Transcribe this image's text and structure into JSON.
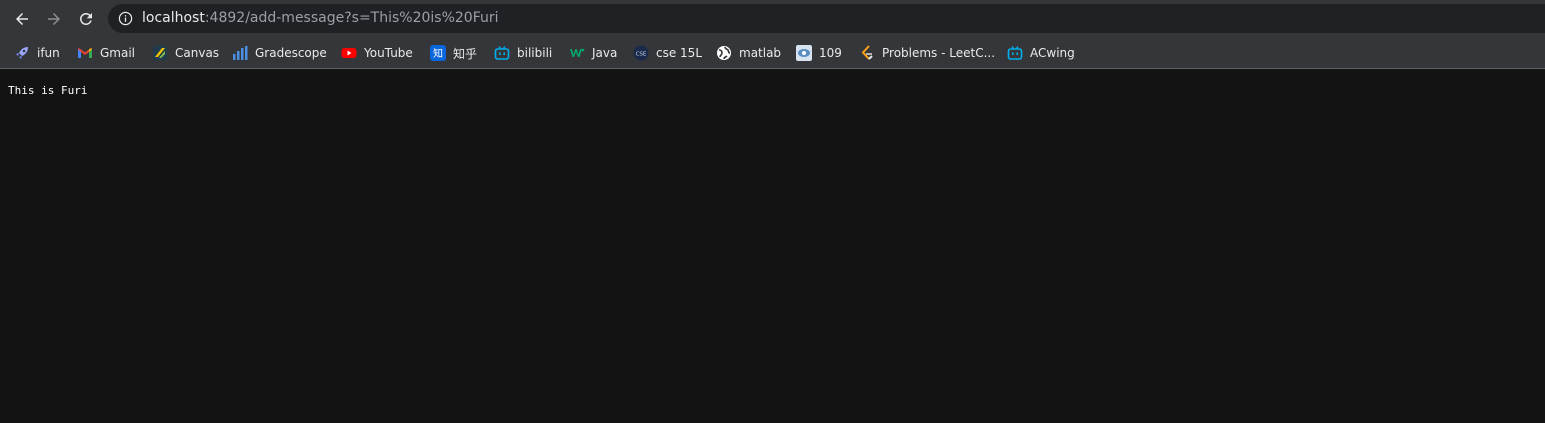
{
  "browser": {
    "url_host": "localhost",
    "url_rest": ":4892/add-message?s=This%20is%20Furi"
  },
  "nav": {
    "back_icon": "arrow-left-icon",
    "forward_icon": "arrow-right-icon",
    "reload_icon": "reload-icon",
    "info_icon": "info-icon"
  },
  "bookmarks": [
    {
      "label": "ifun",
      "icon": "rocket-icon"
    },
    {
      "label": "Gmail",
      "icon": "gmail-icon"
    },
    {
      "label": "Canvas",
      "icon": "canvas-icon"
    },
    {
      "label": "Gradescope",
      "icon": "bar-chart-icon"
    },
    {
      "label": "YouTube",
      "icon": "youtube-icon"
    },
    {
      "label": "知乎",
      "icon": "zhihu-icon"
    },
    {
      "label": "bilibili",
      "icon": "bilibili-icon"
    },
    {
      "label": "Java",
      "icon": "w3-icon"
    },
    {
      "label": "cse 15L",
      "icon": "cse-icon"
    },
    {
      "label": "matlab",
      "icon": "globe-icon"
    },
    {
      "label": "109",
      "icon": "eye-icon"
    },
    {
      "label": "Problems - LeetC...",
      "icon": "leetcode-icon"
    },
    {
      "label": "ACwing",
      "icon": "bilibili-icon"
    }
  ],
  "page": {
    "message": "This is Furi"
  }
}
